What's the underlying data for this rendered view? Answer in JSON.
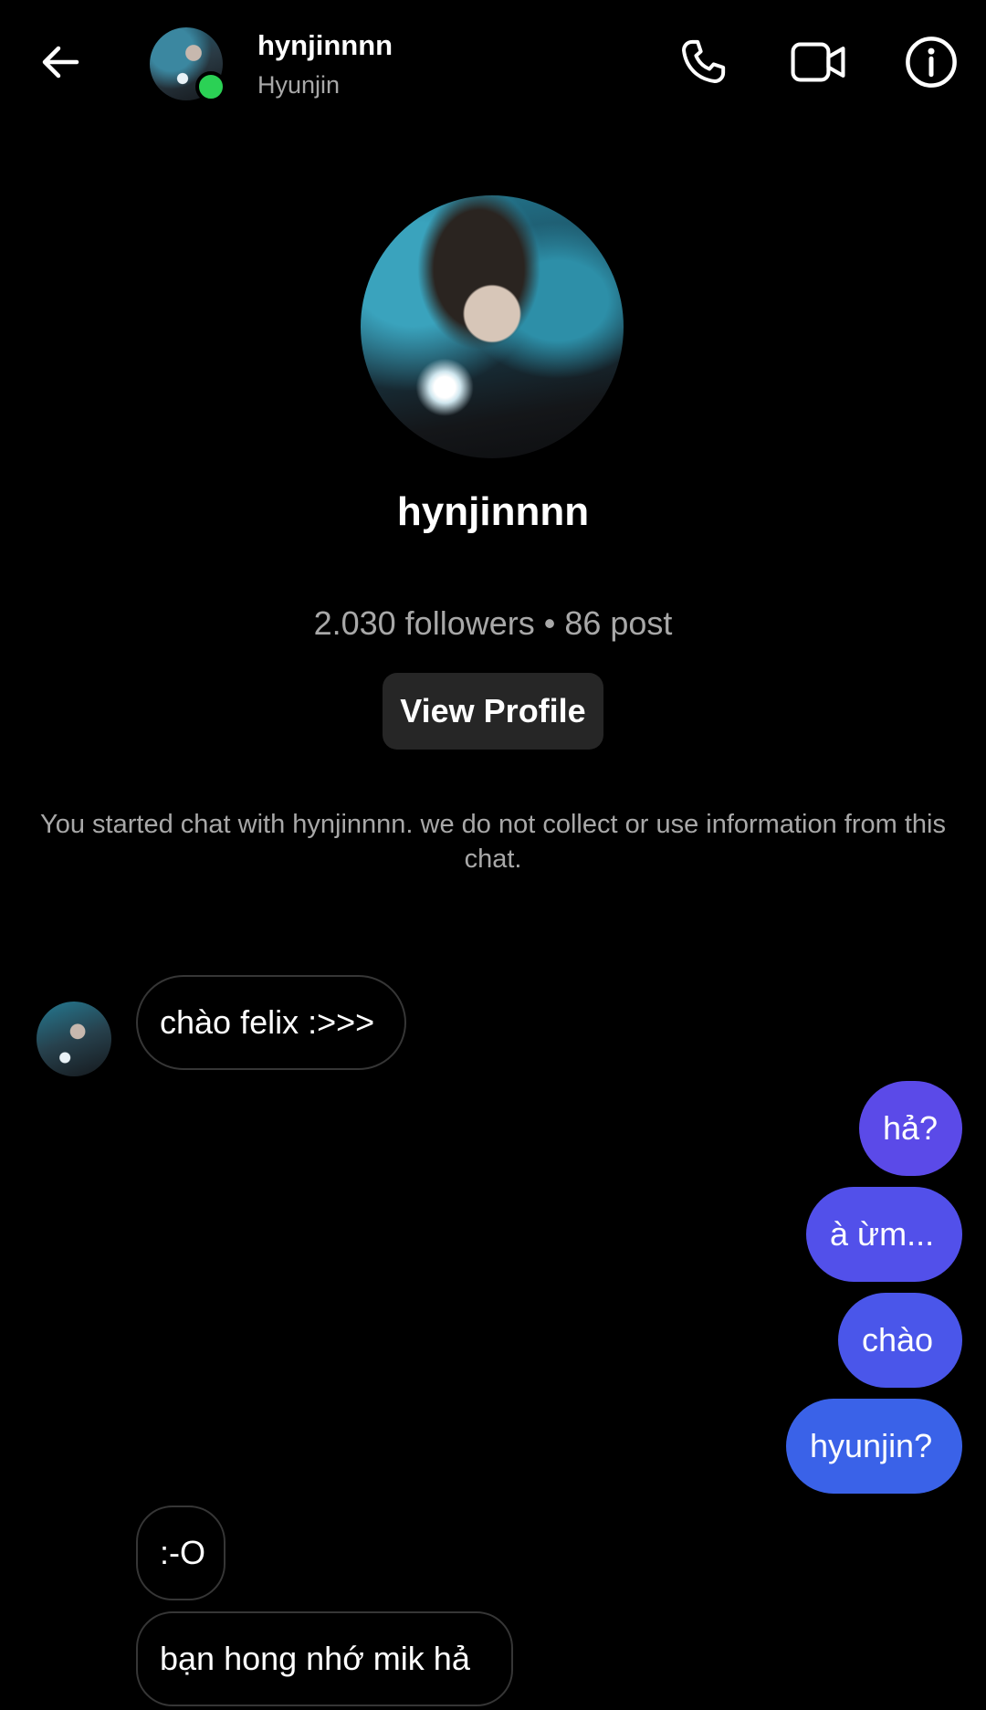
{
  "header": {
    "username": "hynjinnnn",
    "display_name": "Hyunjin",
    "status_color": "#2bd155",
    "icons": [
      "back-arrow-icon",
      "phone-icon",
      "video-camera-icon",
      "info-icon"
    ]
  },
  "profile": {
    "username": "hynjinnnn",
    "stats": "2.030 followers • 86 post",
    "view_profile_label": "View Profile"
  },
  "notice": "You started chat with hynjinnnn. we do not collect or use information from this chat.",
  "messages": [
    {
      "from": "them",
      "text": "chào felix :>>>"
    },
    {
      "from": "me",
      "text": "hả?"
    },
    {
      "from": "me",
      "text": "à ừm..."
    },
    {
      "from": "me",
      "text": "chào"
    },
    {
      "from": "me",
      "text": "hyunjin?"
    },
    {
      "from": "them",
      "text": ":-O"
    },
    {
      "from": "them",
      "text": "bạn hong nhớ mik hả"
    }
  ],
  "colors": {
    "background": "#000000",
    "outgoing_bubble_top": "#5b4ae8",
    "outgoing_bubble_bottom": "#3a62e8",
    "button_bg": "#262626",
    "muted_text": "#a8a8a8"
  }
}
